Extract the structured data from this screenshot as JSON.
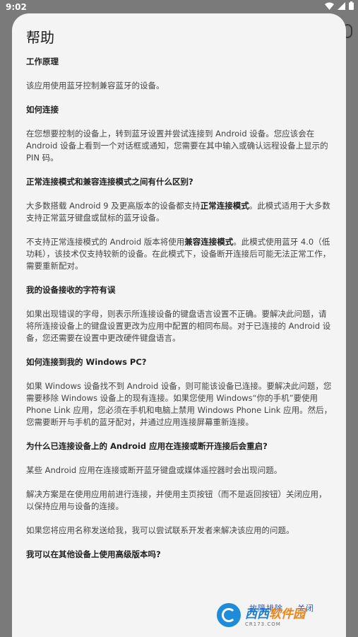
{
  "status_bar": {
    "time": "9:02"
  },
  "dialog": {
    "title": "帮助",
    "sections": [
      {
        "heading": "工作原理"
      },
      {
        "text": "该应用使用蓝牙控制兼容蓝牙的设备。"
      },
      {
        "heading": "如何连接"
      },
      {
        "text": "在您想要控制的设备上，转到蓝牙设置并尝试连接到 Android 设备。您应该会在 Android 设备上看到一个对话框或通知，您需要在其中输入或确认远程设备上显示的 PIN 码。"
      },
      {
        "heading": "正常连接模式和兼容连接模式之间有什么区别?"
      },
      {
        "pre": "大多数搭载 Android 9 及更高版本的设备都支持",
        "bold": "正常连接模式",
        "post": "。此模式适用于大多数支持正常蓝牙键盘或鼠标的蓝牙设备。"
      },
      {
        "pre": "不支持正常连接模式的 Android 版本将使用",
        "bold": "兼容连接模式",
        "post": "。此模式使用蓝牙 4.0（低功耗），该技术仅支持较新的设备。在此模式下，设备断开连接后可能无法正常工作，需要重新配对。"
      },
      {
        "heading": "我的设备接收的字符有误"
      },
      {
        "text": "如果出现错误的字母，则表示所连接设备的键盘语言设置不正确。要解决此问题，请将所连接设备上的键盘设置更改为应用中配置的相同布局。对于已连接的 Android 设备，您还需要在设置中更改硬件键盘语言。"
      },
      {
        "heading": "如何连接到我的 Windows PC?"
      },
      {
        "text": "如果 Windows 设备找不到 Android 设备，则可能该设备已连接。要解决此问题，您需要移除 Windows 设备上的现有连接。如果您使用 Windows“你的手机”要使用 Phone Link 应用，您必须在手机和电脑上禁用 Windows Phone Link 应用。然后，您需要断开与手机的蓝牙配对，并通过应用连接屏幕重新连接。"
      },
      {
        "heading": "为什么已连接设备上的 Android 应用在连接或断开连接后会重启?"
      },
      {
        "text": "某些 Android 应用在连接或断开蓝牙键盘或媒体遥控器时会出现问题。"
      },
      {
        "text": "解决方案是在使用应用前进行连接，并使用主页按钮（而不是返回按钮）关闭应用，以保持应用与设备的连接。"
      },
      {
        "text": "如果您将应用名称发送给我，我可以尝试联系开发者来解决该应用的问题。"
      },
      {
        "heading": "我可以在其他设备上使用高级版本吗?"
      }
    ],
    "footer_buttons": [
      "故障排除",
      "关闭"
    ]
  },
  "watermark": {
    "main_a": "西西",
    "main_b": "软件园",
    "sub": "CR173.COM"
  }
}
